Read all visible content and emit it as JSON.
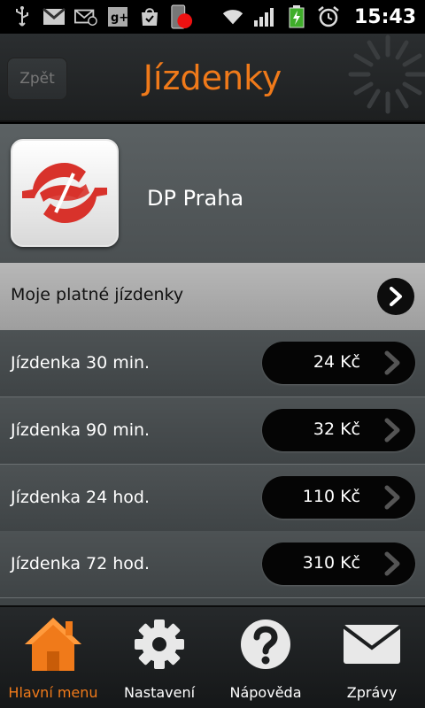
{
  "status_bar": {
    "time": "15:43",
    "left_icons": [
      "usb-icon",
      "gmail-icon",
      "email-icon",
      "google-plus-icon",
      "market-icon",
      "app-notification-icon"
    ],
    "right_icons": [
      "wifi-icon",
      "signal-icon",
      "battery-charging-icon",
      "alarm-icon"
    ]
  },
  "header": {
    "back_label": "Zpět",
    "title": "Jízdenky"
  },
  "provider": {
    "name": "DP Praha",
    "logo_icon": "dp-praha-logo-icon"
  },
  "valid_tickets": {
    "label": "Moje platné jízdenky"
  },
  "tickets": [
    {
      "label": "Jízdenka  30 min.",
      "price": "24 Kč"
    },
    {
      "label": "Jízdenka  90 min.",
      "price": "32 Kč"
    },
    {
      "label": "Jízdenka 24 hod.",
      "price": "110 Kč"
    },
    {
      "label": "Jízdenka 72 hod.",
      "price": "310 Kč"
    }
  ],
  "bottom_nav": [
    {
      "label": "Hlavní menu",
      "icon": "home-icon",
      "active": true
    },
    {
      "label": "Nastavení",
      "icon": "gear-icon",
      "active": false
    },
    {
      "label": "Nápověda",
      "icon": "help-icon",
      "active": false
    },
    {
      "label": "Zprávy",
      "icon": "envelope-icon",
      "active": false
    }
  ],
  "colors": {
    "accent": "#f07a1a",
    "header_bg": "#24272a",
    "list_bg": "#474c4e",
    "button_bg": "#050505"
  }
}
